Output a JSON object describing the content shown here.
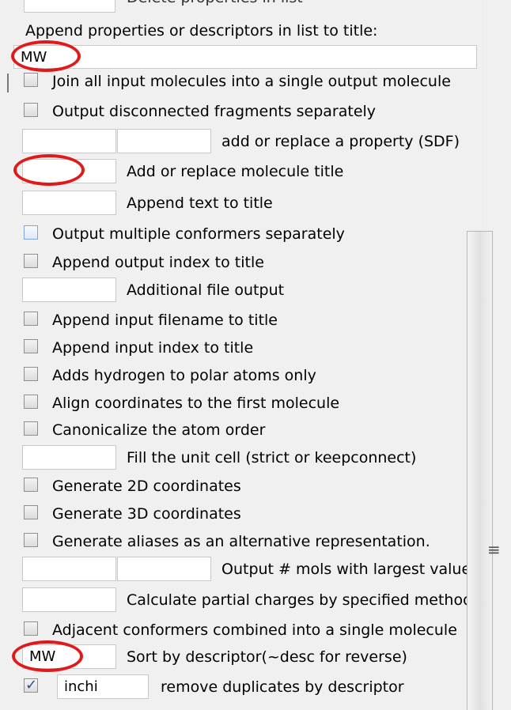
{
  "top_fragment": "Delete properties in list",
  "title_section": {
    "label": "Append properties or descriptors in list to title:",
    "value": "MW"
  },
  "rows": [
    {
      "type": "checkbox",
      "label": "Join all input molecules into a single output molecule",
      "checked": false
    },
    {
      "type": "checkbox",
      "label": "Output disconnected fragments separately",
      "checked": false
    },
    {
      "type": "double-input",
      "label": "add or replace a property (SDF)",
      "value1": "",
      "value2": ""
    },
    {
      "type": "input",
      "label": "Add or replace molecule title",
      "value": ""
    },
    {
      "type": "input",
      "label": "Append text to title",
      "value": ""
    },
    {
      "type": "checkbox",
      "label": "Output multiple conformers separately",
      "checked": false
    },
    {
      "type": "checkbox",
      "label": "Append output index to title",
      "checked": false
    },
    {
      "type": "input",
      "label": "Additional file output",
      "value": ""
    },
    {
      "type": "checkbox",
      "label": "Append input filename to title",
      "checked": false
    },
    {
      "type": "checkbox",
      "label": "Append input index to title",
      "checked": false
    },
    {
      "type": "checkbox",
      "label": "Adds hydrogen to polar atoms only",
      "checked": false
    },
    {
      "type": "checkbox",
      "label": "Align coordinates to the first molecule",
      "checked": false
    },
    {
      "type": "checkbox",
      "label": "Canonicalize the atom order",
      "checked": false
    },
    {
      "type": "input",
      "label": "Fill the unit cell (strict or keepconnect)",
      "value": ""
    },
    {
      "type": "checkbox",
      "label": "Generate 2D coordinates",
      "checked": false
    },
    {
      "type": "checkbox",
      "label": "Generate 3D coordinates",
      "checked": false
    },
    {
      "type": "checkbox",
      "label": "Generate aliases as an alternative representation.",
      "checked": false
    },
    {
      "type": "double-input",
      "label": "Output # mols with largest values",
      "value1": "",
      "value2": ""
    },
    {
      "type": "input",
      "label": "Calculate partial charges by specified method",
      "value": ""
    },
    {
      "type": "checkbox",
      "label": "Adjacent conformers combined into a single molecule",
      "checked": false
    },
    {
      "type": "input",
      "label": "Sort by descriptor(~desc for reverse)",
      "value": "MW"
    },
    {
      "type": "check-input",
      "label": "remove duplicates by descriptor",
      "checked": true,
      "value": "inchi"
    }
  ],
  "scrollbar": {
    "grip": "≡"
  }
}
